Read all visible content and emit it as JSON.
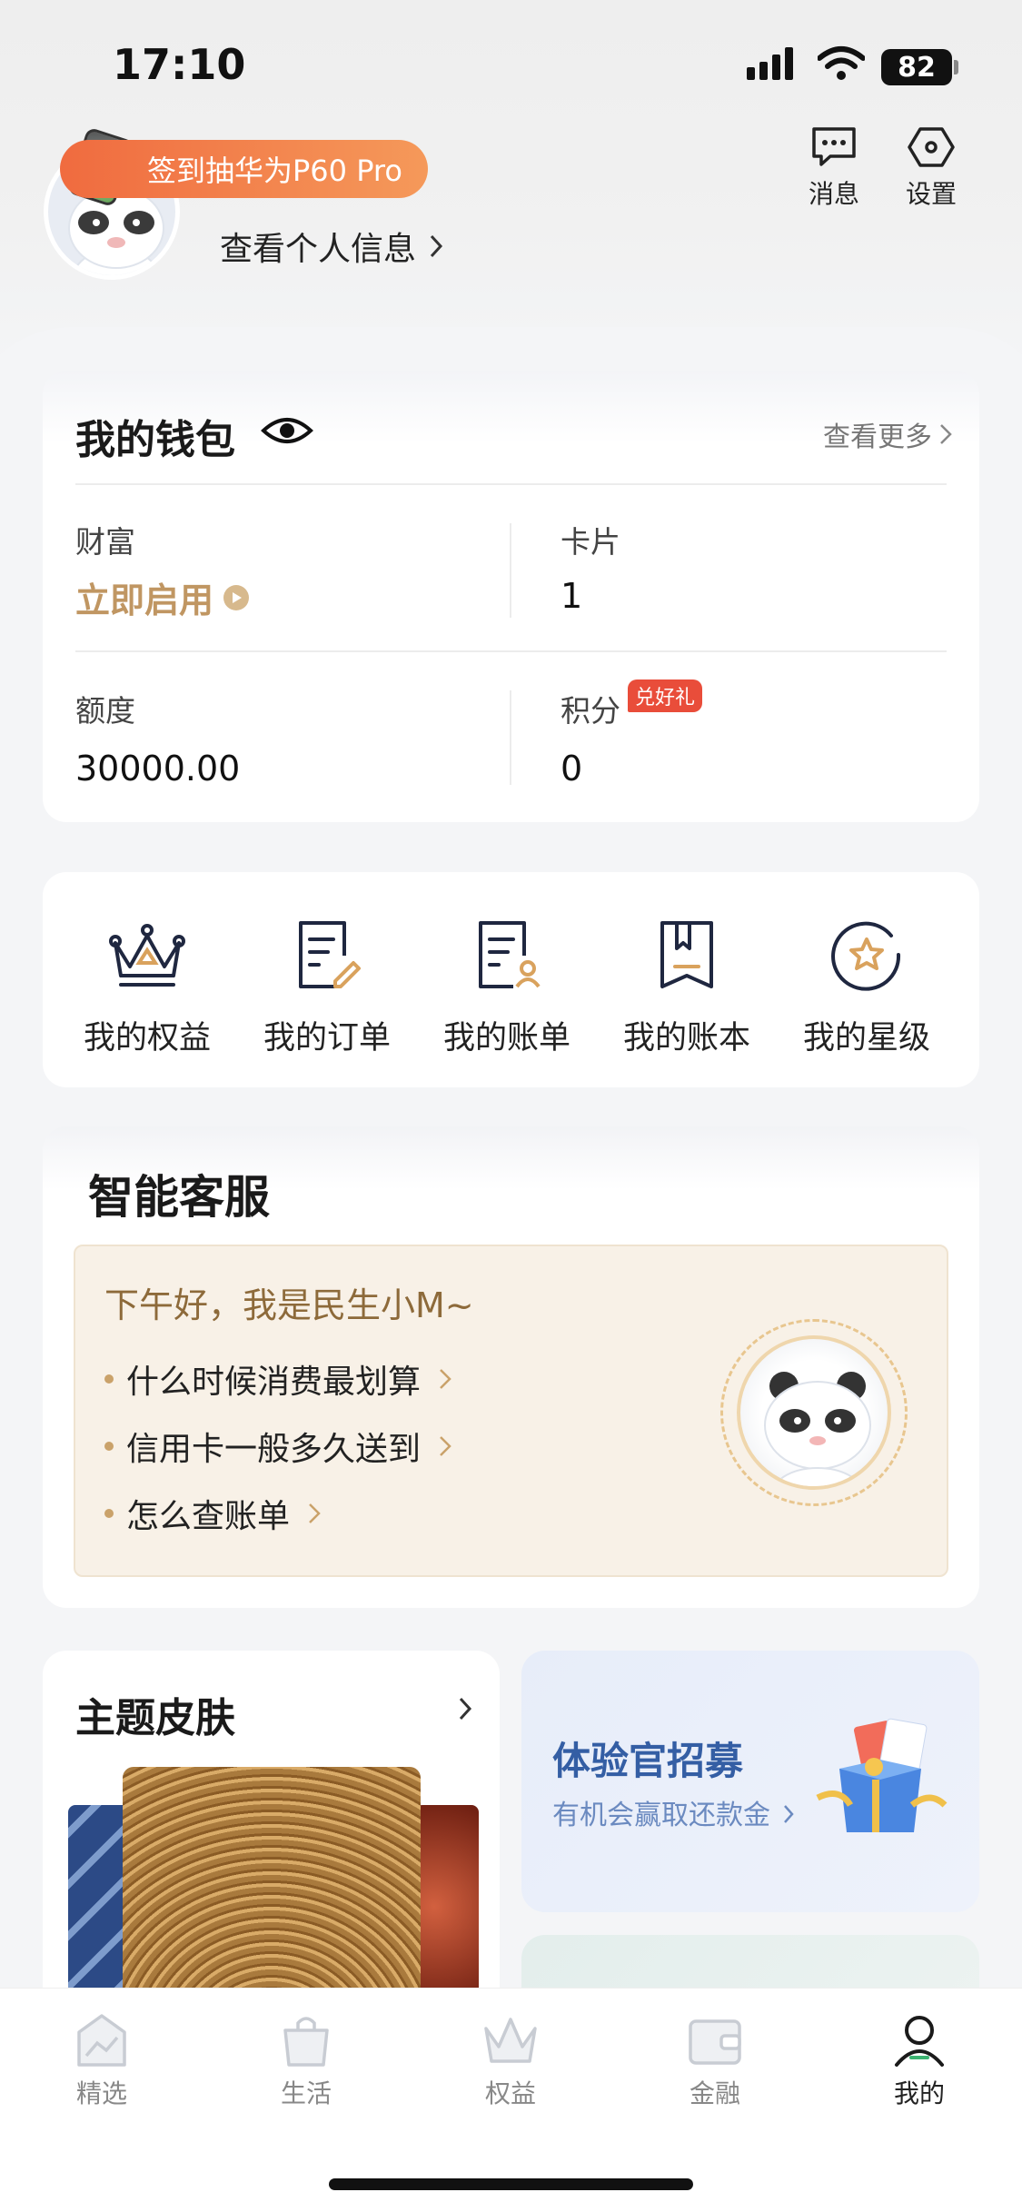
{
  "status_bar": {
    "time": "17:10",
    "battery": "82"
  },
  "profile": {
    "promo": "签到抽华为P60 Pro",
    "view_info": "查看个人信息",
    "messages": "消息",
    "settings": "设置"
  },
  "wallet": {
    "title": "我的钱包",
    "more": "查看更多",
    "wealth_label": "财富",
    "wealth_value": "立即启用",
    "card_label": "卡片",
    "card_value": "1",
    "limit_label": "额度",
    "limit_value": "30000.00",
    "points_label": "积分",
    "points_badge": "兑好礼",
    "points_value": "0"
  },
  "shortcuts": [
    {
      "label": "我的权益",
      "icon": "crown-icon"
    },
    {
      "label": "我的订单",
      "icon": "order-icon"
    },
    {
      "label": "我的账单",
      "icon": "bill-icon"
    },
    {
      "label": "我的账本",
      "icon": "ledger-icon"
    },
    {
      "label": "我的星级",
      "icon": "star-level-icon"
    }
  ],
  "service": {
    "title": "智能客服",
    "greeting": "下午好，我是民生小M~",
    "questions": [
      "什么时候消费最划算",
      "信用卡一般多久送到",
      "怎么查账单"
    ]
  },
  "theme": {
    "title": "主题皮肤"
  },
  "recruit": {
    "title": "体验官招募",
    "subtitle": "有机会赢取还款金"
  },
  "tabs": [
    {
      "label": "精选",
      "icon": "featured-icon"
    },
    {
      "label": "生活",
      "icon": "life-icon"
    },
    {
      "label": "权益",
      "icon": "benefits-icon"
    },
    {
      "label": "金融",
      "icon": "finance-icon"
    },
    {
      "label": "我的",
      "icon": "me-icon"
    }
  ],
  "colors": {
    "accent_gold": "#c09662",
    "promo_orange": "#f06b3f",
    "badge_red": "#e94d3a",
    "recruit_blue": "#345ea4"
  }
}
